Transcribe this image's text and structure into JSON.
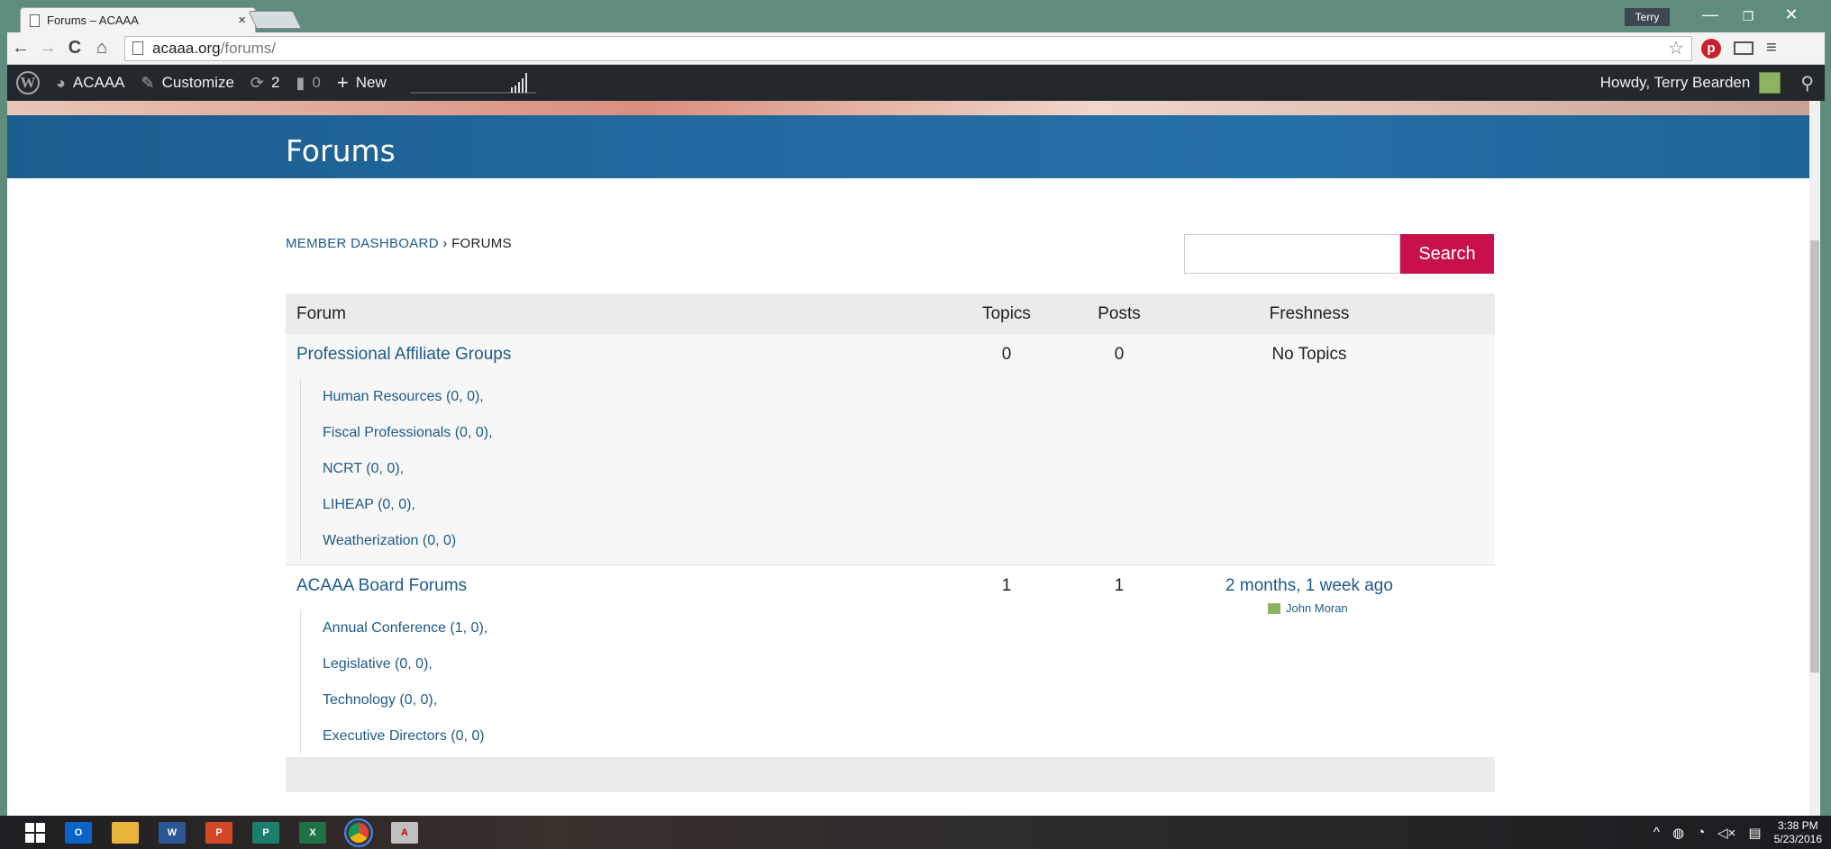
{
  "browser": {
    "tab_title": "Forums – ACAAA",
    "tab_close": "×",
    "profile_name": "Terry",
    "window_controls": {
      "minimize": "—",
      "maximize": "❐",
      "close": "✕"
    },
    "nav": {
      "back": "←",
      "forward": "→",
      "reload": "C",
      "home": "⌂"
    },
    "url_host": "acaaa.org",
    "url_path": "/forums/",
    "bookmark_star": "☆",
    "pinterest": "p",
    "menu": "≡"
  },
  "adminbar": {
    "wp_logo": "W",
    "site_name": "ACAAA",
    "customize": "Customize",
    "updates_count": "2",
    "comments_count": "0",
    "new_label": "New",
    "howdy": "Howdy, Terry Bearden",
    "icons": [
      "wordpress-icon",
      "dashboard-icon",
      "brush-icon",
      "updates-icon",
      "comment-icon",
      "plus-icon",
      "search-icon"
    ]
  },
  "page": {
    "title": "Forums",
    "breadcrumb": {
      "home": "MEMBER DASHBOARD",
      "separator": " › ",
      "current": "FORUMS"
    },
    "search_button": "Search",
    "search_value": ""
  },
  "forums_table": {
    "headers": {
      "forum": "Forum",
      "topics": "Topics",
      "posts": "Posts",
      "freshness": "Freshness"
    },
    "rows": [
      {
        "title": "Professional Affiliate Groups",
        "topics": "0",
        "posts": "0",
        "freshness": "No Topics",
        "freshness_author": "",
        "subforums": [
          "Human Resources (0, 0),",
          "Fiscal Professionals (0, 0),",
          "NCRT (0, 0),",
          "LIHEAP (0, 0),",
          "Weatherization (0, 0)"
        ]
      },
      {
        "title": "ACAAA Board Forums",
        "topics": "1",
        "posts": "1",
        "freshness": "2 months, 1 week ago",
        "freshness_author": "John Moran",
        "subforums": [
          "Annual Conference (1, 0),",
          "Legislative (0, 0),",
          "Technology (0, 0),",
          "Executive Directors (0, 0)"
        ]
      }
    ]
  },
  "taskbar": {
    "apps": [
      "start-icon",
      "outlook-icon",
      "file-explorer-icon",
      "word-icon",
      "powerpoint-icon",
      "publisher-icon",
      "excel-icon",
      "chrome-icon",
      "acrobat-icon"
    ],
    "clock_time": "3:38 PM",
    "clock_date": "5/23/2016"
  }
}
